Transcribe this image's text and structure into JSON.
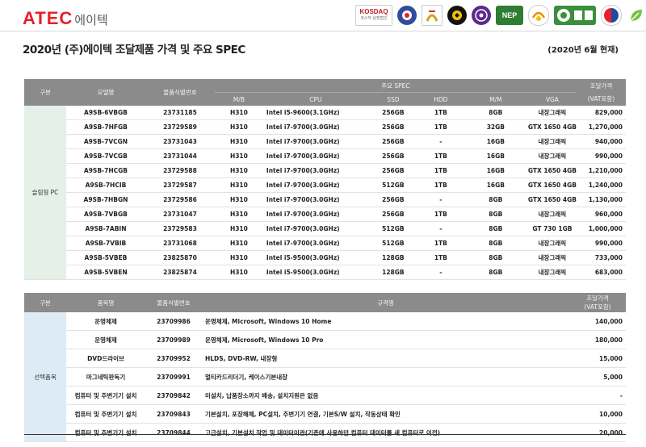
{
  "header": {
    "logo_text": "ATEC",
    "logo_korean": "에이텍",
    "cert_badges": [
      "KOSDAQ",
      "emblem-1",
      "emblem-2",
      "emblem-3",
      "emblem-4",
      "NEP",
      "emblem-6",
      "emblem-7",
      "emblem-8",
      "emblem-9",
      "emblem-10"
    ],
    "kosdaq_sub": "코스닥 상장법인"
  },
  "page": {
    "title": "2020년 (주)에이텍 조달제품 가격 및 주요 SPEC",
    "date": "(2020년 6월 현재)"
  },
  "table1": {
    "headers": {
      "category": "구분",
      "model": "모델명",
      "id": "물품식별번호",
      "spec_group": "주요 SPEC",
      "price": "조달가격",
      "price_sub": "(VAT포함)",
      "spec_cols": [
        "M/B",
        "CPU",
        "SSD",
        "HDD",
        "M/M",
        "VGA"
      ]
    },
    "category_label": "슬림형 PC",
    "rows": [
      [
        "A9SB-6VBGB",
        "23731185",
        "H310",
        "Intel i5-9600(3.1GHz)",
        "256GB",
        "1TB",
        "8GB",
        "내장그래픽",
        "829,000"
      ],
      [
        "A9SB-7HFGB",
        "23729589",
        "H310",
        "Intel i7-9700(3.0GHz)",
        "256GB",
        "1TB",
        "32GB",
        "GTX 1650 4GB",
        "1,270,000"
      ],
      [
        "A9SB-7VCGN",
        "23731043",
        "H310",
        "Intel i7-9700(3.0GHz)",
        "256GB",
        "-",
        "16GB",
        "내장그래픽",
        "940,000"
      ],
      [
        "A9SB-7VCGB",
        "23731044",
        "H310",
        "Intel i7-9700(3.0GHz)",
        "256GB",
        "1TB",
        "16GB",
        "내장그래픽",
        "990,000"
      ],
      [
        "A9SB-7HCGB",
        "23729588",
        "H310",
        "Intel i7-9700(3.0GHz)",
        "256GB",
        "1TB",
        "16GB",
        "GTX 1650 4GB",
        "1,210,000"
      ],
      [
        "A9SB-7HCIB",
        "23729587",
        "H310",
        "Intel i7-9700(3.0GHz)",
        "512GB",
        "1TB",
        "16GB",
        "GTX 1650 4GB",
        "1,240,000"
      ],
      [
        "A9SB-7HBGN",
        "23729586",
        "H310",
        "Intel i7-9700(3.0GHz)",
        "256GB",
        "-",
        "8GB",
        "GTX 1650 4GB",
        "1,130,000"
      ],
      [
        "A9SB-7VBGB",
        "23731047",
        "H310",
        "Intel i7-9700(3.0GHz)",
        "256GB",
        "1TB",
        "8GB",
        "내장그래픽",
        "960,000"
      ],
      [
        "A9SB-7ABIN",
        "23729583",
        "H310",
        "Intel i7-9700(3.0GHz)",
        "512GB",
        "-",
        "8GB",
        "GT 730 1GB",
        "1,000,000"
      ],
      [
        "A9SB-7VBIB",
        "23731068",
        "H310",
        "Intel i7-9700(3.0GHz)",
        "512GB",
        "1TB",
        "8GB",
        "내장그래픽",
        "990,000"
      ],
      [
        "A9SB-5VBEB",
        "23825870",
        "H310",
        "Intel i5-9500(3.0GHz)",
        "128GB",
        "1TB",
        "8GB",
        "내장그래픽",
        "733,000"
      ],
      [
        "A9SB-5VBEN",
        "23825874",
        "H310",
        "Intel i5-9500(3.0GHz)",
        "128GB",
        "-",
        "8GB",
        "내장그래픽",
        "683,000"
      ]
    ]
  },
  "table2": {
    "headers": {
      "category": "구분",
      "product": "품목명",
      "id": "물품식별번호",
      "spec": "규격명",
      "price": "조달가격",
      "price_sub": "(VAT포함)"
    },
    "category_label": "선택품목",
    "rows": [
      [
        "운영체제",
        "23709986",
        "운영체제, Microsoft, Windows 10 Home",
        "140,000"
      ],
      [
        "운영체제",
        "23709989",
        "운영체제, Microsoft, Windows 10 Pro",
        "180,000"
      ],
      [
        "DVD드라이브",
        "23709952",
        "HLDS, DVD-RW, 내장형",
        "15,000"
      ],
      [
        "마그네틱판독기",
        "23709991",
        "멀티카드리더기, 케이스기본내장",
        "5,000"
      ],
      [
        "컴퓨터 및 주변기기 설치",
        "23709842",
        "미설치, 납품장소까지 배송, 설치지원은 없음",
        "-"
      ],
      [
        "컴퓨터 및 주변기기 설치",
        "23709843",
        "기본설치, 포장해체, PC설치, 주변기기 연결, 기본S/W 설치, 작동상태 확인",
        "10,000"
      ],
      [
        "컴퓨터 및 주변기기 설치",
        "23709844",
        "고급설치, 기본설치 작업 및 데이터이관(기존에 사용하던 컴퓨터 데이터를 새 컴퓨터로 이전)",
        "20,000"
      ]
    ]
  }
}
